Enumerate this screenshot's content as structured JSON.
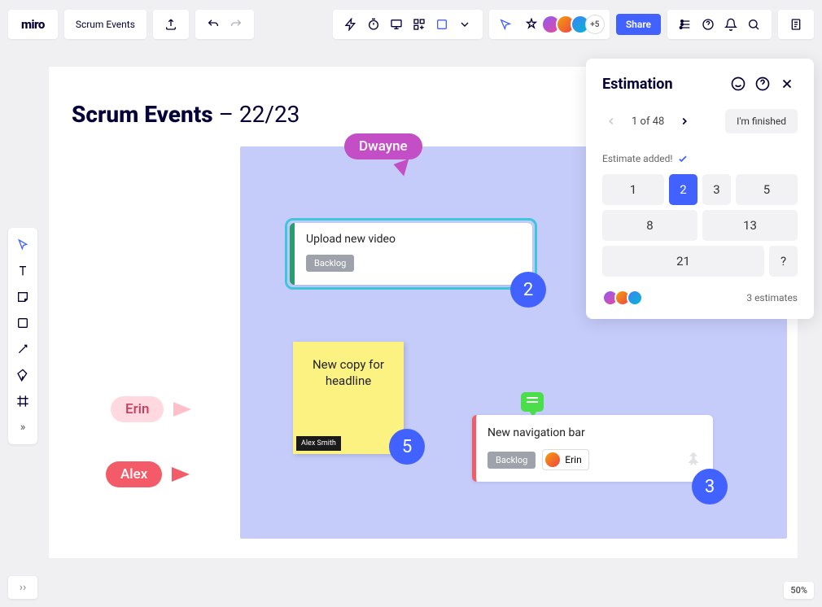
{
  "header": {
    "logo": "miro",
    "board_name": "Scrum Events",
    "avatar_more": "+5",
    "share_label": "Share"
  },
  "zoom": "50%",
  "board": {
    "title_bold": "Scrum Events",
    "title_sep": " – ",
    "title_year": "22/23"
  },
  "cursors": {
    "dwayne": "Dwayne",
    "erin": "Erin",
    "alex": "Alex"
  },
  "card1": {
    "title": "Upload new video",
    "tag": "Backlog",
    "badge": "2"
  },
  "sticky": {
    "text": "New copy for headline",
    "author": "Alex Smith",
    "badge": "5"
  },
  "card2": {
    "title": "New navigation bar",
    "tag": "Backlog",
    "assignee": "Erin",
    "badge": "3"
  },
  "panel": {
    "title": "Estimation",
    "pager": "1 of 48",
    "finished": "I'm finished",
    "status": "Estimate added!",
    "options": [
      "1",
      "2",
      "3",
      "5",
      "8",
      "13",
      "21",
      "?"
    ],
    "selected": "2",
    "estimates": "3 estimates"
  }
}
